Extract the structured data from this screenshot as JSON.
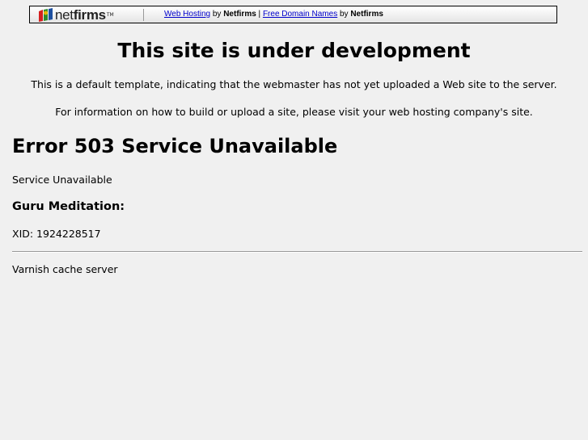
{
  "banner": {
    "logo_net": "net",
    "logo_firms": "firms",
    "logo_tm": "TM",
    "link1": "Web Hosting",
    "by1": " by ",
    "brand1": "Netfirms",
    "sep": " | ",
    "link2": "Free Domain Names",
    "by2": " by ",
    "brand2": "Netfirms"
  },
  "title": "This site is under development",
  "para1": "This is a default template, indicating that the webmaster has not yet uploaded a Web site to the server.",
  "para2": "For information on how to build or upload a site, please visit your web hosting company's site.",
  "error": {
    "heading": "Error 503 Service Unavailable",
    "message": "Service Unavailable",
    "guru_heading": "Guru Meditation:",
    "xid": "XID: 1924228517",
    "footer": "Varnish cache server"
  },
  "colors": {
    "background": "#f0f0f0",
    "link": "#0000cc",
    "logo_red": "#d42020",
    "logo_green": "#2e8b2e",
    "logo_blue": "#1e50a0",
    "logo_yellow": "#e8b800"
  },
  "icons": {
    "logo_mark": "netfirms-logo-icon"
  }
}
